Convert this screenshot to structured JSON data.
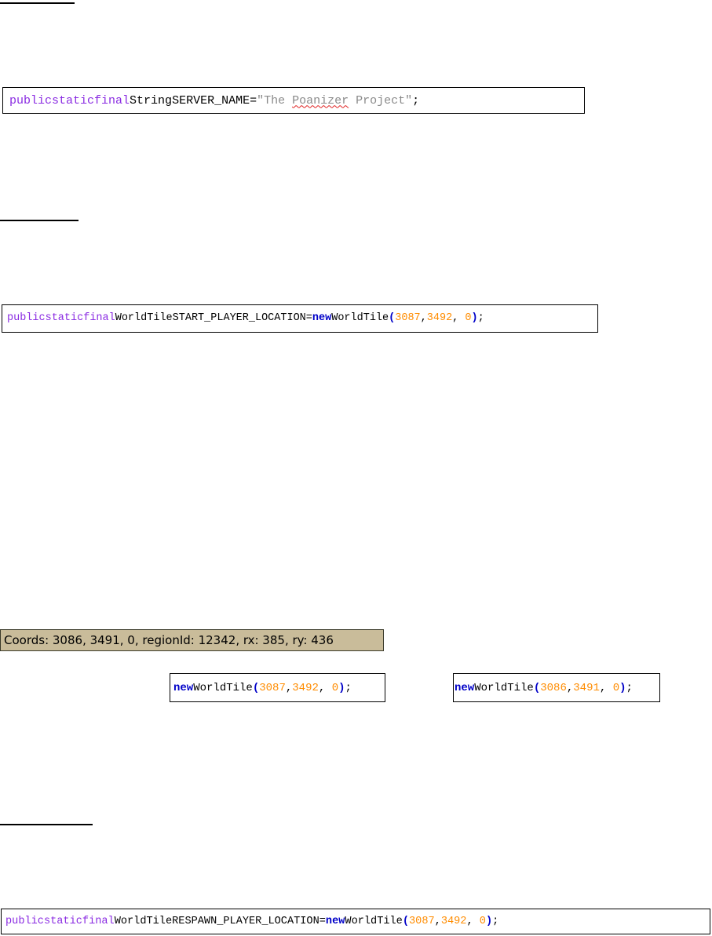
{
  "block1": {
    "kw1": "public",
    "kw2": "static",
    "kw3": "final",
    "type": "String",
    "name": "SERVER_NAME",
    "eq": "=",
    "str_open": "\"The ",
    "str_word": "Poanizer",
    "str_close": " Project\"",
    "semi": ";"
  },
  "block2": {
    "kw1": "public",
    "kw2": "static",
    "kw3": "final",
    "type": "WorldTile",
    "name": "START_PLAYER_LOCATION",
    "eq": "=",
    "new_kw": "new",
    "ctor": "WorldTile",
    "open": "(",
    "x": "3087",
    "c1": ",",
    "y": "3492",
    "c2": ", ",
    "z": "0",
    "close": ")",
    "semi": ";"
  },
  "coords": {
    "text": "Coords: 3086, 3491, 0, regionId: 12342, rx: 385, ry: 436"
  },
  "snippet_a": {
    "new_kw": "new",
    "ctor": "WorldTile",
    "open": "(",
    "x": "3087",
    "c1": ",",
    "y": "3492",
    "c2": ", ",
    "z": "0",
    "close": ")",
    "semi": ";"
  },
  "snippet_b": {
    "new_kw": "new",
    "ctor": "WorldTile",
    "open": "(",
    "x": "3086",
    "c1": ",",
    "y": "3491",
    "c2": ", ",
    "z": "0",
    "close": ")",
    "semi": ";"
  },
  "block3": {
    "kw1": "public",
    "kw2": "static",
    "kw3": "final",
    "type": "WorldTile",
    "name": "RESPAWN_PLAYER_LOCATION",
    "eq": "=",
    "new_kw": "new",
    "ctor": "WorldTile",
    "open": "(",
    "x": "3087",
    "c1": ",",
    "y": "3492",
    "c2": ", ",
    "z": "0",
    "close": ")",
    "semi": ";"
  },
  "colors": {
    "keyword": "#8a2be2",
    "new_keyword": "#0000c8",
    "number": "#ff8c00",
    "string": "#8a8a8a",
    "coords_bg": "#c9bc9a"
  }
}
